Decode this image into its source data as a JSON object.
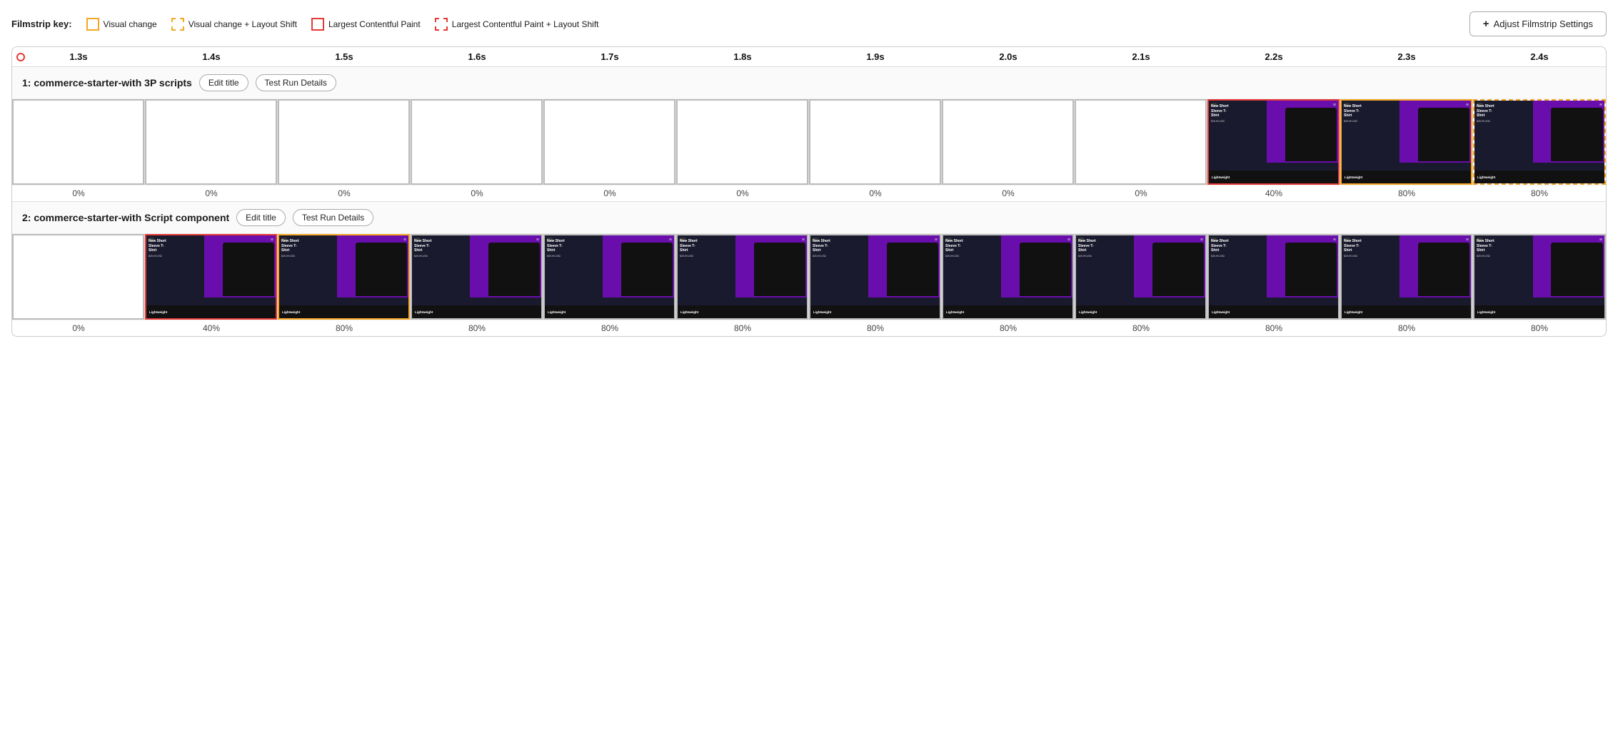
{
  "legend": {
    "label": "Filmstrip key:",
    "items": [
      {
        "id": "visual-change",
        "label": "Visual change",
        "style": "yellow"
      },
      {
        "id": "visual-change-layout-shift",
        "label": "Visual change + Layout Shift",
        "style": "yellow-dashed"
      },
      {
        "id": "lcp",
        "label": "Largest Contentful Paint",
        "style": "red"
      },
      {
        "id": "lcp-layout-shift",
        "label": "Largest Contentful Paint + Layout Shift",
        "style": "red-dashed"
      }
    ],
    "adjust_button": "Adjust Filmstrip Settings"
  },
  "timeline": {
    "times": [
      "1.3s",
      "1.4s",
      "1.5s",
      "1.6s",
      "1.7s",
      "1.8s",
      "1.9s",
      "2.0s",
      "2.1s",
      "2.2s",
      "2.3s",
      "2.4s"
    ]
  },
  "rows": [
    {
      "id": "row1",
      "title": "1: commerce-starter-with 3P scripts",
      "edit_label": "Edit title",
      "details_label": "Test Run Details",
      "frames": [
        {
          "type": "empty",
          "border": "red",
          "percent": "0%"
        },
        {
          "type": "empty",
          "border": "plain",
          "percent": "0%"
        },
        {
          "type": "empty",
          "border": "plain",
          "percent": "0%"
        },
        {
          "type": "empty",
          "border": "plain",
          "percent": "0%"
        },
        {
          "type": "empty",
          "border": "plain",
          "percent": "0%"
        },
        {
          "type": "empty",
          "border": "plain",
          "percent": "0%"
        },
        {
          "type": "empty",
          "border": "plain",
          "percent": "0%"
        },
        {
          "type": "empty",
          "border": "plain",
          "percent": "0%"
        },
        {
          "type": "empty",
          "border": "plain",
          "percent": "0%"
        },
        {
          "type": "product",
          "border": "red",
          "percent": "40%"
        },
        {
          "type": "product",
          "border": "yellow",
          "percent": "80%"
        },
        {
          "type": "product",
          "border": "yellow-dashed",
          "percent": "80%"
        }
      ]
    },
    {
      "id": "row2",
      "title": "2: commerce-starter-with Script component",
      "edit_label": "Edit title",
      "details_label": "Test Run Details",
      "frames": [
        {
          "type": "empty",
          "border": "plain",
          "percent": "0%"
        },
        {
          "type": "product",
          "border": "red",
          "percent": "40%"
        },
        {
          "type": "product",
          "border": "yellow",
          "percent": "80%"
        },
        {
          "type": "product",
          "border": "plain",
          "percent": "80%"
        },
        {
          "type": "product",
          "border": "plain",
          "percent": "80%"
        },
        {
          "type": "product",
          "border": "plain",
          "percent": "80%"
        },
        {
          "type": "product",
          "border": "plain",
          "percent": "80%"
        },
        {
          "type": "product",
          "border": "plain",
          "percent": "80%"
        },
        {
          "type": "product",
          "border": "plain",
          "percent": "80%"
        },
        {
          "type": "product",
          "border": "plain",
          "percent": "80%"
        },
        {
          "type": "product",
          "border": "plain",
          "percent": "80%"
        },
        {
          "type": "product",
          "border": "plain",
          "percent": "80%"
        }
      ]
    }
  ],
  "product_card": {
    "title_lines": "New Short\nSleeve T-\nShirt",
    "price": "$25.99 USD",
    "bottom_label": "Lightweight"
  }
}
